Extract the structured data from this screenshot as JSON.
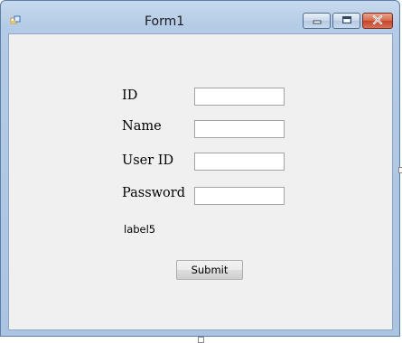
{
  "window": {
    "title": "Form1"
  },
  "icons": {
    "app": "app-icon",
    "minimize": "minimize-icon",
    "maximize": "maximize-icon",
    "close": "close-icon"
  },
  "form": {
    "id_label": "ID",
    "id_value": "",
    "name_label": "Name",
    "name_value": "",
    "userid_label": "User ID",
    "userid_value": "",
    "password_label": "Password",
    "password_value": "",
    "label5": "label5",
    "submit_label": "Submit"
  },
  "colors": {
    "frame": "#aac4e2",
    "client_bg": "#f0f0f0",
    "close_button": "#c5432a"
  }
}
